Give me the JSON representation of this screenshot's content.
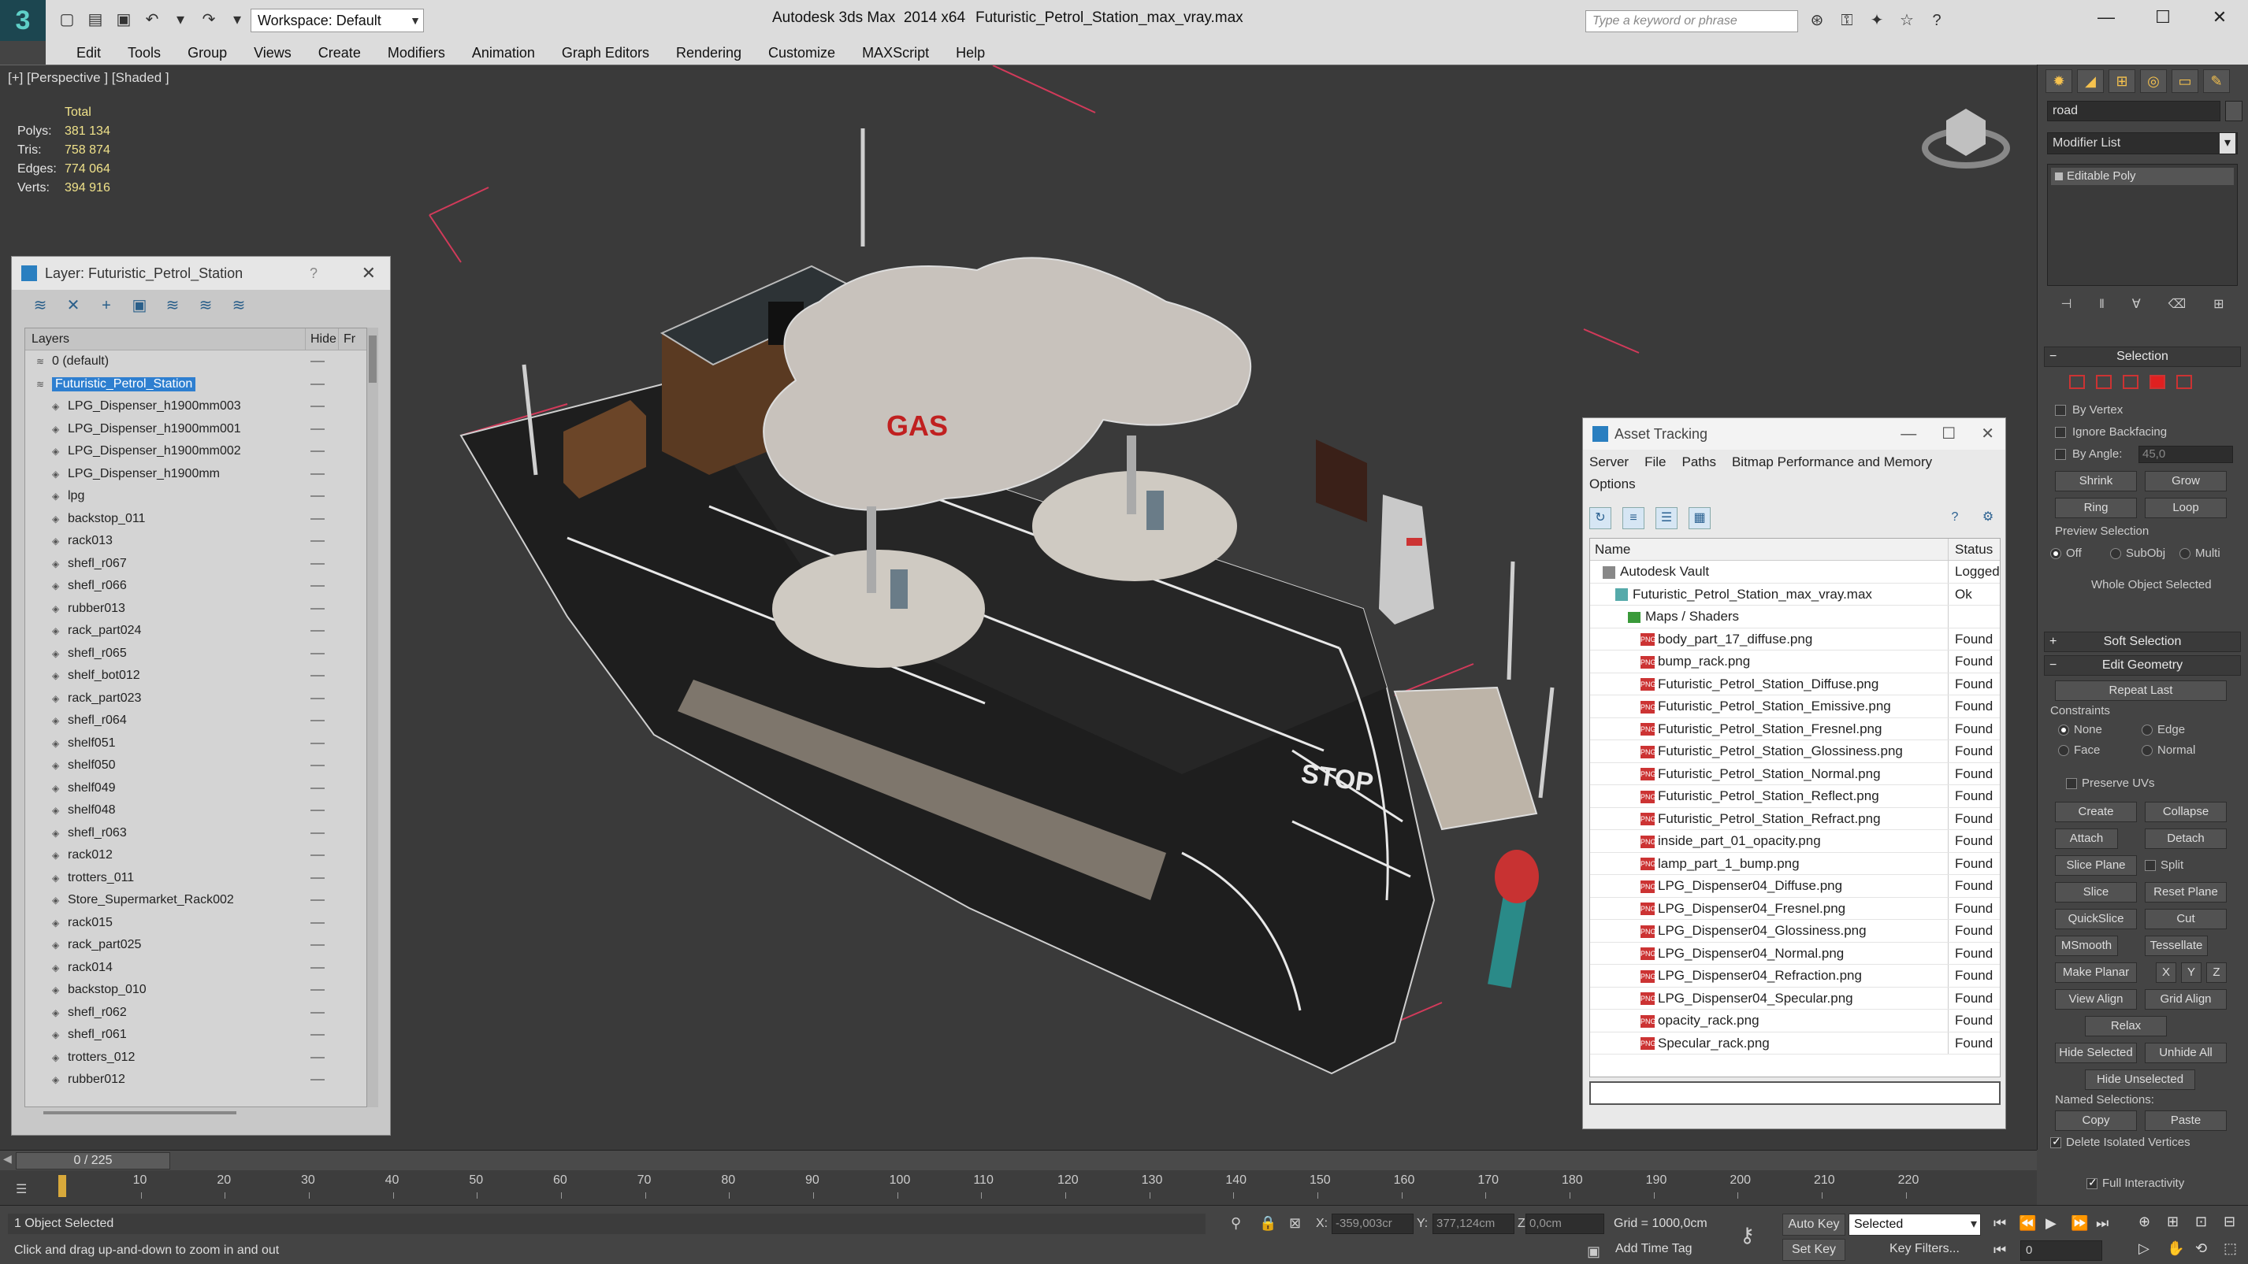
{
  "app": {
    "title": "Autodesk 3ds Max  2014 x64",
    "file": "Futuristic_Petrol_Station_max_vray.max",
    "workspace": "Workspace: Default",
    "search_placeholder": "Type a keyword or phrase"
  },
  "menu": [
    "Edit",
    "Tools",
    "Group",
    "Views",
    "Create",
    "Modifiers",
    "Animation",
    "Graph Editors",
    "Rendering",
    "Customize",
    "MAXScript",
    "Help"
  ],
  "viewport": {
    "label": "[+] [Perspective ] [Shaded ]",
    "stats": {
      "total_label": "Total",
      "rows": [
        {
          "k": "Polys:",
          "v": "381 134"
        },
        {
          "k": "Tris:",
          "v": "758 874"
        },
        {
          "k": "Edges:",
          "v": "774 064"
        },
        {
          "k": "Verts:",
          "v": "394 916"
        }
      ]
    },
    "scene_text": {
      "canopy": "GAS",
      "road": "STOP"
    }
  },
  "layer_window": {
    "title": "Layer: Futuristic_Petrol_Station",
    "help": "?",
    "close": "✕",
    "col_layers": "Layers",
    "col_hide": "Hide",
    "col_fr": "Fr",
    "items": [
      {
        "name": "0 (default)",
        "level": 0
      },
      {
        "name": "Futuristic_Petrol_Station",
        "level": 0,
        "selected": true
      },
      {
        "name": "LPG_Dispenser_h1900mm003",
        "level": 1
      },
      {
        "name": "LPG_Dispenser_h1900mm001",
        "level": 1
      },
      {
        "name": "LPG_Dispenser_h1900mm002",
        "level": 1
      },
      {
        "name": "LPG_Dispenser_h1900mm",
        "level": 1
      },
      {
        "name": "lpg",
        "level": 1
      },
      {
        "name": "backstop_011",
        "level": 1
      },
      {
        "name": "rack013",
        "level": 1
      },
      {
        "name": "shefl_r067",
        "level": 1
      },
      {
        "name": "shefl_r066",
        "level": 1
      },
      {
        "name": "rubber013",
        "level": 1
      },
      {
        "name": "rack_part024",
        "level": 1
      },
      {
        "name": "shefl_r065",
        "level": 1
      },
      {
        "name": "shelf_bot012",
        "level": 1
      },
      {
        "name": "rack_part023",
        "level": 1
      },
      {
        "name": "shefl_r064",
        "level": 1
      },
      {
        "name": "shelf051",
        "level": 1
      },
      {
        "name": "shelf050",
        "level": 1
      },
      {
        "name": "shelf049",
        "level": 1
      },
      {
        "name": "shelf048",
        "level": 1
      },
      {
        "name": "shefl_r063",
        "level": 1
      },
      {
        "name": "rack012",
        "level": 1
      },
      {
        "name": "trotters_011",
        "level": 1
      },
      {
        "name": "Store_Supermarket_Rack002",
        "level": 1
      },
      {
        "name": "rack015",
        "level": 1
      },
      {
        "name": "rack_part025",
        "level": 1
      },
      {
        "name": "rack014",
        "level": 1
      },
      {
        "name": "backstop_010",
        "level": 1
      },
      {
        "name": "shefl_r062",
        "level": 1
      },
      {
        "name": "shefl_r061",
        "level": 1
      },
      {
        "name": "trotters_012",
        "level": 1
      },
      {
        "name": "rubber012",
        "level": 1
      }
    ]
  },
  "asset_window": {
    "title": "Asset Tracking",
    "menu": [
      "Server",
      "File",
      "Paths",
      "Bitmap Performance and Memory",
      "Options"
    ],
    "col_name": "Name",
    "col_status": "Status",
    "rows": [
      {
        "name": "Autodesk Vault",
        "status": "Logged",
        "type": "vault",
        "indent": 1
      },
      {
        "name": "Futuristic_Petrol_Station_max_vray.max",
        "status": "Ok",
        "type": "max",
        "indent": 2
      },
      {
        "name": "Maps / Shaders",
        "status": "",
        "type": "folder",
        "indent": 3
      },
      {
        "name": "body_part_17_diffuse.png",
        "status": "Found",
        "type": "png",
        "indent": 4
      },
      {
        "name": "bump_rack.png",
        "status": "Found",
        "type": "png",
        "indent": 4
      },
      {
        "name": "Futuristic_Petrol_Station_Diffuse.png",
        "status": "Found",
        "type": "png",
        "indent": 4
      },
      {
        "name": "Futuristic_Petrol_Station_Emissive.png",
        "status": "Found",
        "type": "png",
        "indent": 4
      },
      {
        "name": "Futuristic_Petrol_Station_Fresnel.png",
        "status": "Found",
        "type": "png",
        "indent": 4
      },
      {
        "name": "Futuristic_Petrol_Station_Glossiness.png",
        "status": "Found",
        "type": "png",
        "indent": 4
      },
      {
        "name": "Futuristic_Petrol_Station_Normal.png",
        "status": "Found",
        "type": "png",
        "indent": 4
      },
      {
        "name": "Futuristic_Petrol_Station_Reflect.png",
        "status": "Found",
        "type": "png",
        "indent": 4
      },
      {
        "name": "Futuristic_Petrol_Station_Refract.png",
        "status": "Found",
        "type": "png",
        "indent": 4
      },
      {
        "name": "inside_part_01_opacity.png",
        "status": "Found",
        "type": "png",
        "indent": 4
      },
      {
        "name": "lamp_part_1_bump.png",
        "status": "Found",
        "type": "png",
        "indent": 4
      },
      {
        "name": "LPG_Dispenser04_Diffuse.png",
        "status": "Found",
        "type": "png",
        "indent": 4
      },
      {
        "name": "LPG_Dispenser04_Fresnel.png",
        "status": "Found",
        "type": "png",
        "indent": 4
      },
      {
        "name": "LPG_Dispenser04_Glossiness.png",
        "status": "Found",
        "type": "png",
        "indent": 4
      },
      {
        "name": "LPG_Dispenser04_Normal.png",
        "status": "Found",
        "type": "png",
        "indent": 4
      },
      {
        "name": "LPG_Dispenser04_Refraction.png",
        "status": "Found",
        "type": "png",
        "indent": 4
      },
      {
        "name": "LPG_Dispenser04_Specular.png",
        "status": "Found",
        "type": "png",
        "indent": 4
      },
      {
        "name": "opacity_rack.png",
        "status": "Found",
        "type": "png",
        "indent": 4
      },
      {
        "name": "Specular_rack.png",
        "status": "Found",
        "type": "png",
        "indent": 4
      }
    ]
  },
  "command_panel": {
    "object_name": "road",
    "modifier_list": "Modifier List",
    "stack_item": "Editable Poly",
    "selection": {
      "title": "Selection",
      "by_vertex": "By Vertex",
      "ignore_backfacing": "Ignore Backfacing",
      "by_angle": "By Angle:",
      "angle_value": "45,0",
      "shrink": "Shrink",
      "grow": "Grow",
      "ring": "Ring",
      "loop": "Loop",
      "preview_selection": "Preview Selection",
      "off": "Off",
      "subobj": "SubObj",
      "multi": "Multi",
      "whole_object": "Whole Object Selected"
    },
    "soft_selection": "Soft Selection",
    "edit_geometry": {
      "title": "Edit Geometry",
      "repeat_last": "Repeat Last",
      "constraints": "Constraints",
      "none": "None",
      "edge": "Edge",
      "face": "Face",
      "normal": "Normal",
      "preserve_uvs": "Preserve UVs",
      "create": "Create",
      "collapse": "Collapse",
      "attach": "Attach",
      "detach": "Detach",
      "slice_plane": "Slice Plane",
      "split": "Split",
      "slice": "Slice",
      "reset_plane": "Reset Plane",
      "quickslice": "QuickSlice",
      "cut": "Cut",
      "msmooth": "MSmooth",
      "tessellate": "Tessellate",
      "make_planar": "Make Planar",
      "x": "X",
      "y": "Y",
      "z": "Z",
      "view_align": "View Align",
      "grid_align": "Grid Align",
      "relax": "Relax",
      "hide_selected": "Hide Selected",
      "unhide_all": "Unhide All",
      "hide_unselected": "Hide Unselected",
      "named_selections": "Named Selections:",
      "copy": "Copy",
      "paste": "Paste",
      "delete_isolated": "Delete Isolated Vertices",
      "full_interactivity": "Full Interactivity"
    }
  },
  "timeline": {
    "frame_display": "0 / 225",
    "ticks": [
      "10",
      "20",
      "30",
      "40",
      "50",
      "60",
      "70",
      "80",
      "90",
      "100",
      "110",
      "120",
      "130",
      "140",
      "150",
      "160",
      "170",
      "180",
      "190",
      "200",
      "210",
      "220"
    ],
    "max_frame": 225
  },
  "status": {
    "selected": "1 Object Selected",
    "prompt": "Click and drag up-and-down to zoom in and out",
    "x_label": "X:",
    "x_value": "-359,003cr",
    "y_label": "Y:",
    "y_value": "377,124cm",
    "z_label": "Z:",
    "z_value": "0,0cm",
    "grid": "Grid = 1000,0cm",
    "add_time_tag": "Add Time Tag",
    "auto_key": "Auto Key",
    "set_key": "Set Key",
    "key_mode": "Selected",
    "key_filters": "Key Filters...",
    "frame": "0"
  }
}
